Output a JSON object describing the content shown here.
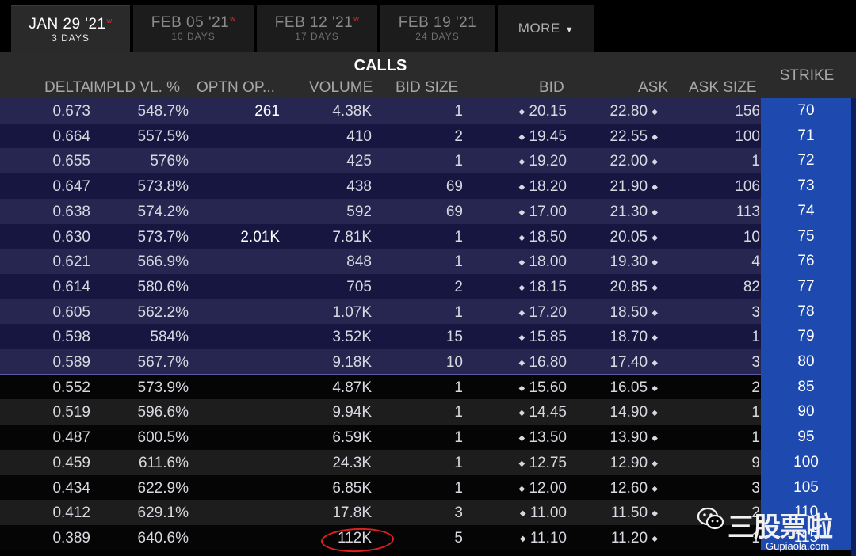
{
  "tabs": [
    {
      "date": "JAN 29 '21",
      "weekly": "w",
      "days": "3 DAYS",
      "active": true
    },
    {
      "date": "FEB 05 '21",
      "weekly": "w",
      "days": "10 DAYS",
      "active": false
    },
    {
      "date": "FEB 12 '21",
      "weekly": "w",
      "days": "17 DAYS",
      "active": false
    },
    {
      "date": "FEB 19 '21",
      "weekly": "",
      "days": "24 DAYS",
      "active": false
    }
  ],
  "more": {
    "label": "MORE",
    "icon": "caret-down-icon"
  },
  "header": {
    "calls_title": "CALLS",
    "columns": {
      "delta": "DELTA",
      "iv": "IMPLD VL. %",
      "oi": "OPTN OP...",
      "volume": "VOLUME",
      "bid_size": "BID SIZE",
      "bid": "BID",
      "ask": "ASK",
      "ask_size": "ASK SIZE",
      "strike": "STRIKE"
    }
  },
  "rows": [
    {
      "delta": "0.673",
      "iv": "548.7%",
      "oi": "261",
      "volume": "4.38K",
      "bid_size": "1",
      "bid": "20.15",
      "ask": "22.80",
      "ask_size": "156",
      "strike": "70",
      "itm": true
    },
    {
      "delta": "0.664",
      "iv": "557.5%",
      "oi": "",
      "volume": "410",
      "bid_size": "2",
      "bid": "19.45",
      "ask": "22.55",
      "ask_size": "100",
      "strike": "71",
      "itm": true
    },
    {
      "delta": "0.655",
      "iv": "576%",
      "oi": "",
      "volume": "425",
      "bid_size": "1",
      "bid": "19.20",
      "ask": "22.00",
      "ask_size": "1",
      "strike": "72",
      "itm": true
    },
    {
      "delta": "0.647",
      "iv": "573.8%",
      "oi": "",
      "volume": "438",
      "bid_size": "69",
      "bid": "18.20",
      "ask": "21.90",
      "ask_size": "106",
      "strike": "73",
      "itm": true
    },
    {
      "delta": "0.638",
      "iv": "574.2%",
      "oi": "",
      "volume": "592",
      "bid_size": "69",
      "bid": "17.00",
      "ask": "21.30",
      "ask_size": "113",
      "strike": "74",
      "itm": true
    },
    {
      "delta": "0.630",
      "iv": "573.7%",
      "oi": "2.01K",
      "volume": "7.81K",
      "bid_size": "1",
      "bid": "18.50",
      "ask": "20.05",
      "ask_size": "10",
      "strike": "75",
      "itm": true
    },
    {
      "delta": "0.621",
      "iv": "566.9%",
      "oi": "",
      "volume": "848",
      "bid_size": "1",
      "bid": "18.00",
      "ask": "19.30",
      "ask_size": "4",
      "strike": "76",
      "itm": true
    },
    {
      "delta": "0.614",
      "iv": "580.6%",
      "oi": "",
      "volume": "705",
      "bid_size": "2",
      "bid": "18.15",
      "ask": "20.85",
      "ask_size": "82",
      "strike": "77",
      "itm": true
    },
    {
      "delta": "0.605",
      "iv": "562.2%",
      "oi": "",
      "volume": "1.07K",
      "bid_size": "1",
      "bid": "17.20",
      "ask": "18.50",
      "ask_size": "3",
      "strike": "78",
      "itm": true
    },
    {
      "delta": "0.598",
      "iv": "584%",
      "oi": "",
      "volume": "3.52K",
      "bid_size": "15",
      "bid": "15.85",
      "ask": "18.70",
      "ask_size": "1",
      "strike": "79",
      "itm": true
    },
    {
      "delta": "0.589",
      "iv": "567.7%",
      "oi": "",
      "volume": "9.18K",
      "bid_size": "10",
      "bid": "16.80",
      "ask": "17.40",
      "ask_size": "3",
      "strike": "80",
      "itm": true
    },
    {
      "delta": "0.552",
      "iv": "573.9%",
      "oi": "",
      "volume": "4.87K",
      "bid_size": "1",
      "bid": "15.60",
      "ask": "16.05",
      "ask_size": "2",
      "strike": "85",
      "itm": false
    },
    {
      "delta": "0.519",
      "iv": "596.6%",
      "oi": "",
      "volume": "9.94K",
      "bid_size": "1",
      "bid": "14.45",
      "ask": "14.90",
      "ask_size": "1",
      "strike": "90",
      "itm": false
    },
    {
      "delta": "0.487",
      "iv": "600.5%",
      "oi": "",
      "volume": "6.59K",
      "bid_size": "1",
      "bid": "13.50",
      "ask": "13.90",
      "ask_size": "1",
      "strike": "95",
      "itm": false
    },
    {
      "delta": "0.459",
      "iv": "611.6%",
      "oi": "",
      "volume": "24.3K",
      "bid_size": "1",
      "bid": "12.75",
      "ask": "12.90",
      "ask_size": "9",
      "strike": "100",
      "itm": false
    },
    {
      "delta": "0.434",
      "iv": "622.9%",
      "oi": "",
      "volume": "6.85K",
      "bid_size": "1",
      "bid": "12.00",
      "ask": "12.60",
      "ask_size": "3",
      "strike": "105",
      "itm": false
    },
    {
      "delta": "0.412",
      "iv": "629.1%",
      "oi": "",
      "volume": "17.8K",
      "bid_size": "3",
      "bid": "11.00",
      "ask": "11.50",
      "ask_size": "2",
      "strike": "110",
      "itm": false
    },
    {
      "delta": "0.389",
      "iv": "640.6%",
      "oi": "",
      "volume": "112K",
      "bid_size": "5",
      "bid": "11.10",
      "ask": "11.20",
      "ask_size": "1",
      "strike": "115",
      "itm": false
    }
  ],
  "bid_marker": "◆",
  "ask_marker": "◆",
  "highlight": {
    "row_volume": "112K",
    "color": "#e02020"
  },
  "watermark": {
    "brand": "三股票啦",
    "site": "Gupiaola.com"
  },
  "colors": {
    "itm_row_a": "#262650",
    "itm_row_b": "#161640",
    "strike_bg": "#1e4ab0",
    "weekly_marker": "#d03030"
  }
}
